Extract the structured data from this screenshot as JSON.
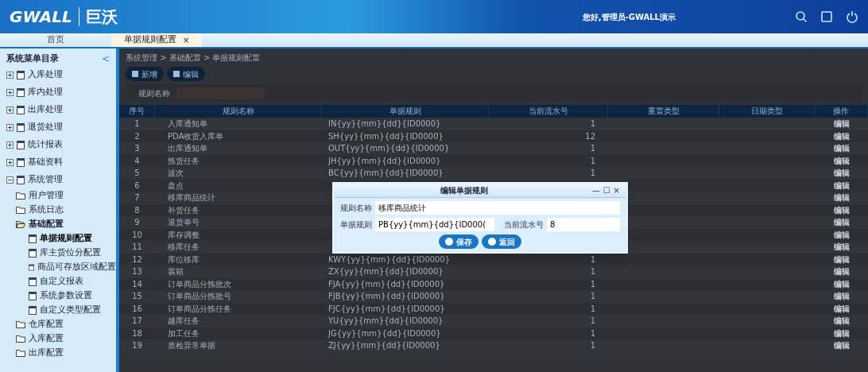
{
  "header": {
    "logo_latin": "GWALL",
    "logo_cn": "巨沃",
    "user": "您好,管理员-GWALL演示"
  },
  "tabs": [
    {
      "label": "首页",
      "selected": false
    },
    {
      "label": "单据规则配置",
      "selected": true,
      "close": "×"
    }
  ],
  "sidebar": {
    "title": "系统菜单目录",
    "collapse": "<",
    "items": [
      {
        "label": "入库处理",
        "expanded": false
      },
      {
        "label": "库内处理",
        "expanded": false
      },
      {
        "label": "出库处理",
        "expanded": false
      },
      {
        "label": "退货处理",
        "expanded": false
      },
      {
        "label": "统计报表",
        "expanded": false
      },
      {
        "label": "基础资料",
        "expanded": false
      },
      {
        "label": "系统管理",
        "expanded": true,
        "children": [
          {
            "label": "用户管理",
            "expanded": false
          },
          {
            "label": "系统日志",
            "expanded": false
          },
          {
            "label": "基础配置",
            "expanded": true,
            "children": [
              {
                "label": "单据规则配置",
                "selected": true
              },
              {
                "label": "库主货位分配置",
                "selected": false
              },
              {
                "label": "商品可存放区域配置",
                "selected": false
              },
              {
                "label": "自定义报表",
                "selected": false
              },
              {
                "label": "系统参数设置",
                "selected": false
              },
              {
                "label": "自定义类型配置",
                "selected": false
              }
            ]
          },
          {
            "label": "仓库配置",
            "expanded": false
          },
          {
            "label": "入库配置",
            "expanded": false
          },
          {
            "label": "出库配置",
            "expanded": false
          }
        ]
      }
    ]
  },
  "breadcrumb": "系统管理 > 基础配置 > 单据规则配置",
  "toolbar": [
    "新增",
    "编辑"
  ],
  "search": {
    "label": "规则名称"
  },
  "table": {
    "columns": [
      "序号",
      "规则名称",
      "单据规则",
      "当前流水号",
      "重置类型",
      "日期类型",
      "操作"
    ],
    "rows": [
      [
        "1",
        "入库通知单",
        "IN{yy}{mm}{dd}{ID0000}",
        "1",
        null,
        null,
        "编辑"
      ],
      [
        "2",
        "PDA收货入库单",
        "SH{yy}{mm}{dd}{ID0000}",
        "12",
        null,
        null,
        "编辑"
      ],
      [
        "3",
        "出库通知单",
        "OUT{yy}{mm}{dd}{ID0000}",
        "1",
        null,
        null,
        "编辑"
      ],
      [
        "4",
        "拣货任务",
        "JH{yy}{mm}{dd}{ID0000}",
        "1",
        null,
        null,
        "编辑"
      ],
      [
        "5",
        "波次",
        "BC{yy}{mm}{dd}{ID0000}",
        "1",
        null,
        null,
        "编辑"
      ],
      [
        "6",
        "盘点",
        null,
        null,
        null,
        null,
        "编辑"
      ],
      [
        "7",
        "移库商品统计",
        null,
        null,
        null,
        null,
        "编辑"
      ],
      [
        "8",
        "补货任务",
        null,
        null,
        null,
        null,
        "编辑"
      ],
      [
        "9",
        "退货单号",
        null,
        null,
        null,
        null,
        "编辑"
      ],
      [
        "10",
        "库存调整",
        null,
        null,
        null,
        null,
        "编辑"
      ],
      [
        "11",
        "移库任务",
        null,
        null,
        null,
        null,
        "编辑"
      ],
      [
        "12",
        "库位移库",
        "KWY{yy}{mm}{dd}{ID0000}",
        "1",
        null,
        null,
        "编辑"
      ],
      [
        "13",
        "装箱",
        "ZX{yy}{mm}{dd}{ID0000}",
        "1",
        null,
        null,
        "编辑"
      ],
      [
        "14",
        "订单商品分拣批次",
        "FJA{yy}{mm}{dd}{ID0000}",
        "1",
        null,
        null,
        "编辑"
      ],
      [
        "15",
        "订单商品分拣批号",
        "FJB{yy}{mm}{dd}{ID0000}",
        "1",
        null,
        null,
        "编辑"
      ],
      [
        "16",
        "订单商品分拣任务",
        "FJC{yy}{mm}{dd}{ID0000}",
        "1",
        null,
        null,
        "编辑"
      ],
      [
        "17",
        "越库任务",
        "YU{yy}{mm}{dd}{ID0000}",
        "1",
        null,
        null,
        "编辑"
      ],
      [
        "18",
        "加工任务",
        "JG{yy}{mm}{dd}{ID0000}",
        "1",
        null,
        null,
        "编辑"
      ],
      [
        "19",
        "质检异常单据",
        "ZJ{yy}{mm}{dd}{ID0000}",
        "1",
        null,
        null,
        "编辑"
      ]
    ]
  },
  "dialog": {
    "title": "编辑单据规则",
    "controls": [
      "—",
      "☐",
      "×"
    ],
    "fields": [
      {
        "label": "规则名称",
        "value": "移库商品统计"
      },
      {
        "label": "单据规则",
        "value": "PB{yy}{mm}{dd}{ID000("
      },
      {
        "label": "当前流水号",
        "value": "8"
      }
    ],
    "buttons": [
      "保存",
      "返回"
    ]
  }
}
